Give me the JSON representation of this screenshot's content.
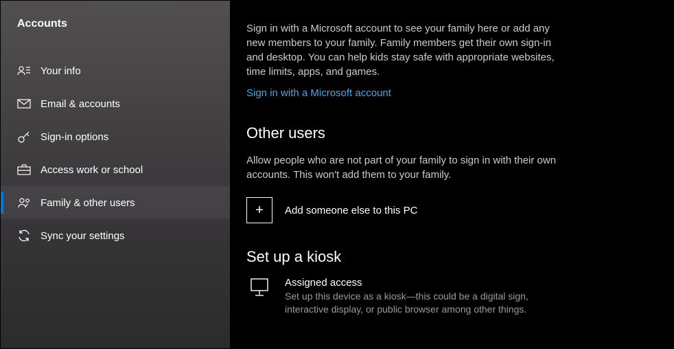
{
  "sidebar": {
    "title": "Accounts",
    "items": [
      {
        "label": "Your info"
      },
      {
        "label": "Email & accounts"
      },
      {
        "label": "Sign-in options"
      },
      {
        "label": "Access work or school"
      },
      {
        "label": "Family & other users"
      },
      {
        "label": "Sync your settings"
      }
    ]
  },
  "main": {
    "intro": "Sign in with a Microsoft account to see your family here or add any new members to your family. Family members get their own sign-in and desktop. You can help kids stay safe with appropriate websites, time limits, apps, and games.",
    "signin_link": "Sign in with a Microsoft account",
    "other_users": {
      "heading": "Other users",
      "text": "Allow people who are not part of your family to sign in with their own accounts. This won't add them to your family.",
      "add_label": "Add someone else to this PC"
    },
    "kiosk": {
      "heading": "Set up a kiosk",
      "title": "Assigned access",
      "desc": "Set up this device as a kiosk—this could be a digital sign, interactive display, or public browser among other things."
    }
  }
}
